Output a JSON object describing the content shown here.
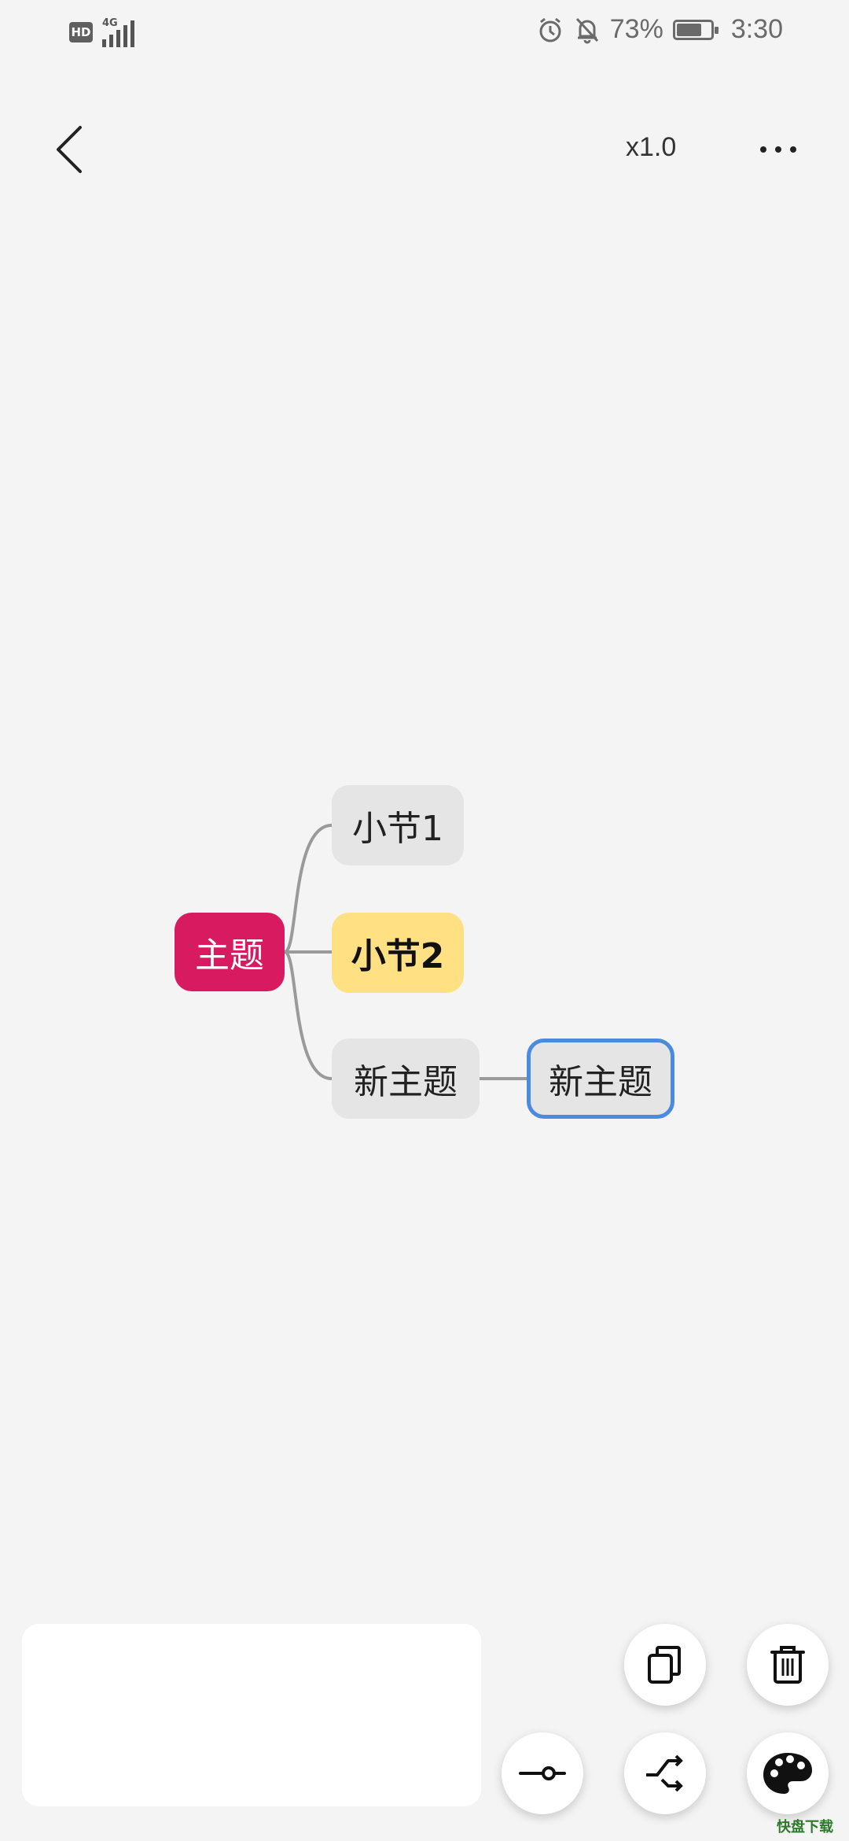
{
  "status_bar": {
    "hd_label": "HD",
    "network": "4G",
    "battery_percent": "73%",
    "battery_level": 0.73,
    "time": "3:30",
    "icons": [
      "hd-icon",
      "signal-icon",
      "alarm-icon",
      "bell-off-icon",
      "battery-icon"
    ]
  },
  "toolbar": {
    "back_icon": "chevron-left-icon",
    "zoom_label": "x1.0",
    "more_icon": "more-horizontal-icon"
  },
  "mindmap": {
    "root": {
      "label": "主题",
      "color": "#d81b60"
    },
    "children": [
      {
        "label": "小节1",
        "color": "#e5e5e5"
      },
      {
        "label": "小节2",
        "color": "#ffe082"
      },
      {
        "label": "新主题",
        "color": "#e5e5e5",
        "children": [
          {
            "label": "新主题",
            "selected": true,
            "border_color": "#4a8ae0"
          }
        ]
      }
    ],
    "connector_color": "#9a9a9a"
  },
  "bottom_actions": {
    "copy_icon": "copy-icon",
    "delete_icon": "trash-icon",
    "slider_icon": "slider-icon",
    "branch_icon": "branch-icon",
    "palette_icon": "palette-icon"
  },
  "watermark": "快盘下载"
}
